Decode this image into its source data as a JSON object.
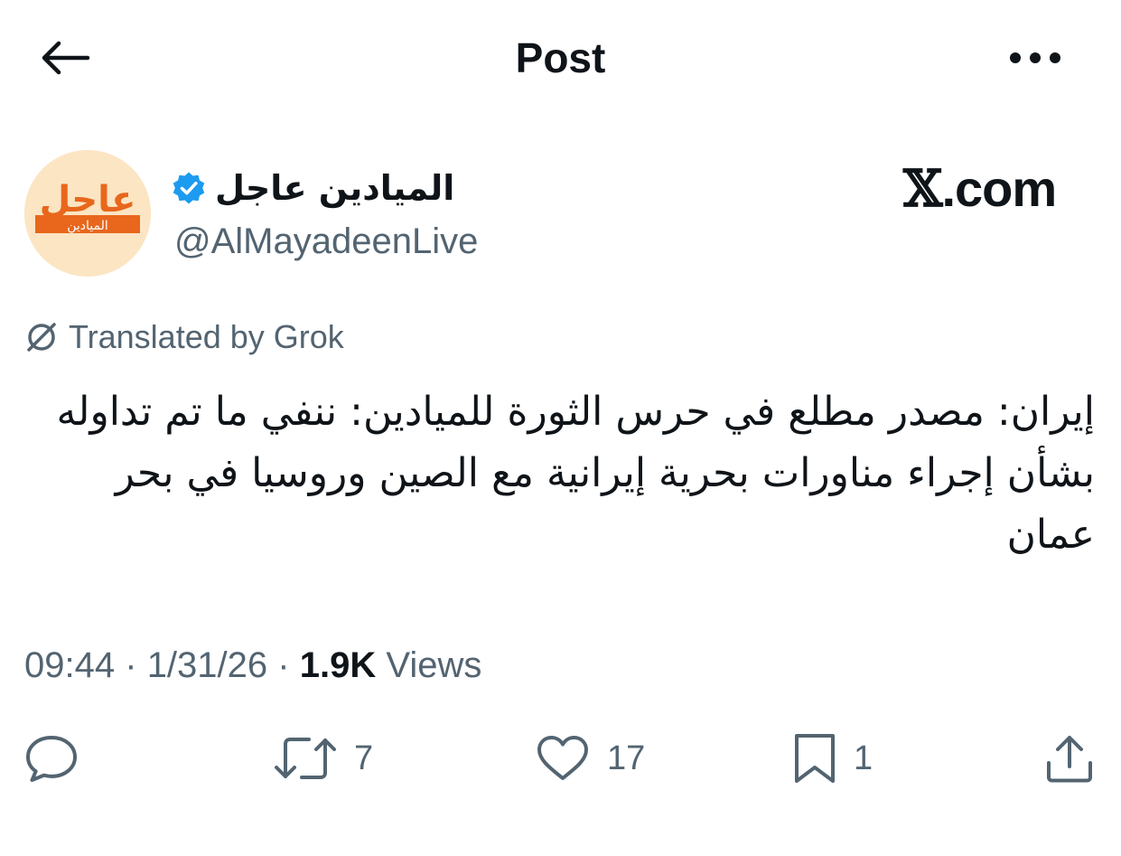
{
  "header": {
    "title": "Post",
    "back_icon": "arrow-left-icon",
    "more_icon": "more-horizontal-icon"
  },
  "author": {
    "display_name": "الميادين عاجل",
    "handle": "@AlMayadeenLive",
    "verified": true,
    "verified_color": "#1d9bf0",
    "avatar": {
      "headline": "عاجل",
      "subtitle": "الميادين",
      "accent_color": "#e8671c",
      "background_color": "#fbe5c3"
    }
  },
  "watermark": {
    "x_glyph": "𝕏",
    "suffix": ".com"
  },
  "translation": {
    "label": "Translated by Grok",
    "icon": "translate-off-icon"
  },
  "tweet": {
    "text": "إيران: مصدر مطلع في حرس الثورة للميادين: ننفي ما تم تداوله بشأن إجراء مناورات بحرية إيرانية مع الصين وروسيا في بحر عمان"
  },
  "meta": {
    "time": "09:44",
    "separator": "·",
    "date": "1/31/26",
    "views_count": "1.9K",
    "views_label": "Views"
  },
  "actions": {
    "reply": {
      "icon": "reply-icon",
      "count": ""
    },
    "repost": {
      "icon": "repost-icon",
      "count": "7"
    },
    "like": {
      "icon": "heart-icon",
      "count": "17"
    },
    "bookmark": {
      "icon": "bookmark-icon",
      "count": "1"
    },
    "share": {
      "icon": "share-icon",
      "count": ""
    }
  },
  "colors": {
    "text_primary": "#0f1419",
    "text_secondary": "#536471"
  }
}
